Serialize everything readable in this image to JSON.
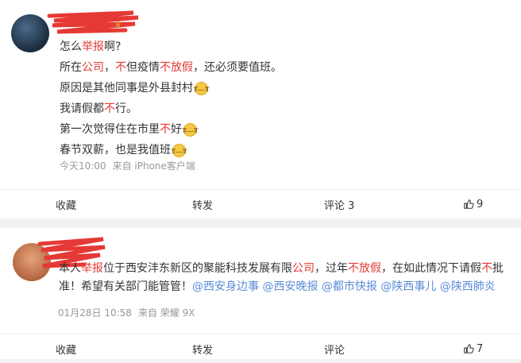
{
  "post1": {
    "line1": {
      "pre": "怎么",
      "red": "举报",
      "post": "啊?"
    },
    "line2": {
      "a": "所在",
      "b": "公司",
      "c": "，",
      "d": "不",
      "e": "但疫情",
      "f": "不放假",
      "g": "，还必须要值班。"
    },
    "line3": {
      "text": "原因是其他同事是外县封村"
    },
    "line4": {
      "pre": "我请假都",
      "red": "不",
      "post": "行。"
    },
    "line5": {
      "pre": "第一次觉得住在市里",
      "red": "不",
      "post": "好"
    },
    "line6": {
      "text": "春节双薪，也是我值班"
    },
    "time": "今天10:00",
    "source": "来自 iPhone客户端",
    "actions": {
      "fav": "收藏",
      "share": "转发",
      "comment": "评论 3",
      "like": "9"
    }
  },
  "post2": {
    "t1": "本人",
    "t2": "举报",
    "t3": "位于西安沣东新区的聚能科技发展有限",
    "t4": "公司",
    "t5": "，过年",
    "t6": "不放假",
    "t7": "，在如此情况下请假",
    "t8": "不",
    "t9": "批准！希望有关部门能管管！",
    "mentions": [
      "@西安身边事",
      "@西安晚报",
      "@都市快报",
      "@陕西事儿",
      "@陕西肺炎"
    ],
    "time": "01月28日 10:58",
    "source": "来自 荣耀 9X",
    "actions": {
      "fav": "收藏",
      "share": "转发",
      "comment": "评论",
      "like": "7"
    }
  },
  "colors": {
    "highlight": "#e53935",
    "link": "#5b8bd8",
    "meta": "#999999"
  },
  "icons": {
    "emoji": "crying-face-emoji-icon",
    "like": "thumbs-up-icon"
  }
}
